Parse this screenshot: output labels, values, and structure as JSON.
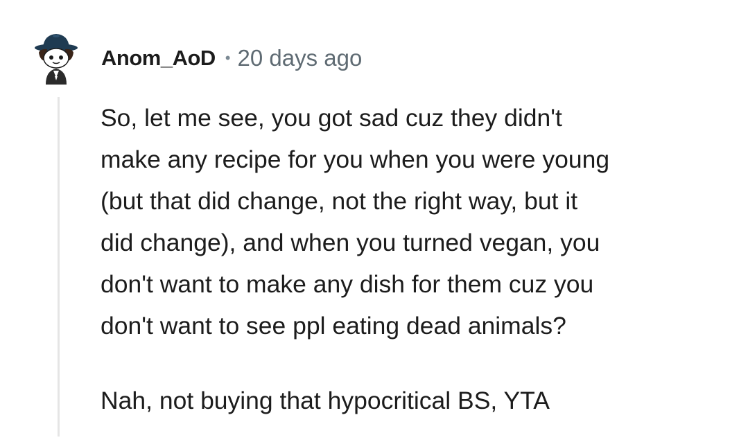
{
  "comment": {
    "author": "Anom_AoD",
    "separator": "•",
    "timestamp": "20 days ago",
    "paragraphs": [
      "So, let me see, you got sad cuz they didn't\nmake any recipe for you when you were young\n(but that did change, not the right way, but it\ndid change), and when you turned vegan, you\ndon't want to make any dish for them cuz you\ndon't want to see ppl eating dead animals?",
      "Nah, not buying that hypocritical BS, YTA"
    ],
    "avatar_icon": "snoo-avatar-icon"
  },
  "colors": {
    "text": "#1c1c1c",
    "meta": "#5f6b73",
    "thread_line": "#e5e5e5",
    "hat": "#1f3b52"
  }
}
